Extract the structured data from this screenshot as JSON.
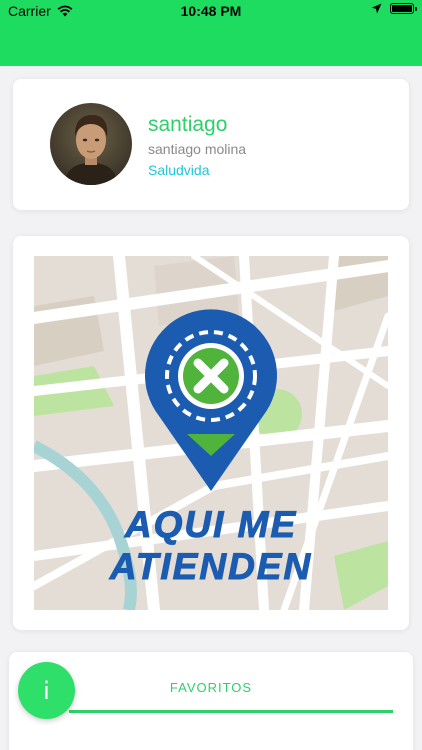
{
  "status_bar": {
    "carrier": "Carrier",
    "time": "10:48 PM",
    "icons": [
      "wifi-icon",
      "location-arrow-icon",
      "battery-icon"
    ]
  },
  "colors": {
    "accent_green": "#1ddc5f",
    "name_green": "#2ed06a",
    "org_cyan": "#1ec7d9",
    "brand_blue": "#1c5cb0"
  },
  "profile": {
    "username": "santiago",
    "full_name": "santiago molina",
    "organization": "Saludvida"
  },
  "logo": {
    "text": "AQUI ME ATIENDEN"
  },
  "favorites": {
    "label": "FAVORITOS"
  },
  "fab": {
    "label": "i"
  }
}
